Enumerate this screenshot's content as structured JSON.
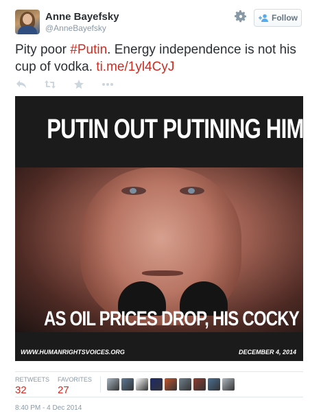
{
  "author": {
    "name": "Anne Bayefsky",
    "handle": "@AnneBayefsky"
  },
  "follow_button": {
    "label": "Follow",
    "icon": "add-user-icon"
  },
  "tweet": {
    "text_before": "Pity poor ",
    "hashtag": "#Putin",
    "text_after": ". Energy independence is not his cup of vodka. ",
    "link": "ti.me/1yl4CyJ"
  },
  "actions": [
    "reply-icon",
    "retweet-icon",
    "favorite-icon",
    "more-icon"
  ],
  "media": {
    "headline_top": "PUTIN OUT PUTINING HIMSELF.",
    "headline_bottom": "AS OIL PRICES DROP, HIS COCKY SMILE FADES",
    "credit_left": "WWW.HUMANRIGHTSVOICES.ORG",
    "credit_right": "DECEMBER 4, 2014"
  },
  "stats": {
    "retweets_label": "RETWEETS",
    "retweets": "32",
    "favorites_label": "FAVORITES",
    "favorites": "27"
  },
  "favoriter_avatar_colors": [
    "#a7b4bf",
    "#5d7a96",
    "#ffffff",
    "#1c2a6b",
    "#c0552b",
    "#6f7f8c",
    "#8b3d2f",
    "#4a6f93",
    "#b0b8c0"
  ],
  "timestamp": "8:40 PM - 4 Dec 2014",
  "colors": {
    "link": "#d12a1f",
    "muted": "#8899a6"
  }
}
